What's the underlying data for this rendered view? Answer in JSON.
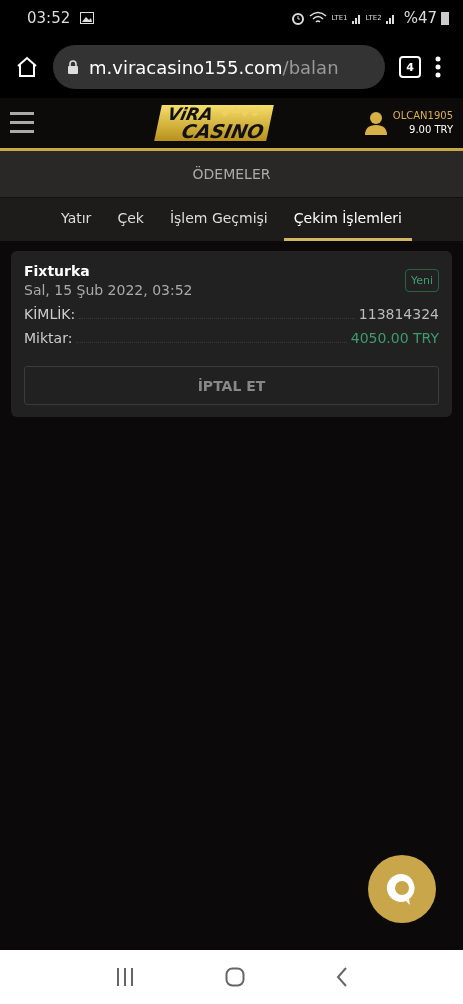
{
  "status_bar": {
    "time": "03:52",
    "sims": [
      "LTE1",
      "LTE2"
    ],
    "battery": "%47"
  },
  "browser": {
    "url_host": "m.viracasino155.com",
    "url_path": "/balan",
    "tab_count": "4"
  },
  "header": {
    "logo": [
      "ViRA",
      "CASINO"
    ],
    "username": "OLCAN1905",
    "balance": "9.00 TRY"
  },
  "section_title": "ÖDEMELER",
  "tabs": [
    {
      "label": "Yatır",
      "selected": false
    },
    {
      "label": "Çek",
      "selected": false
    },
    {
      "label": "İşlem Geçmişi",
      "selected": false
    },
    {
      "label": "Çekim İşlemleri",
      "selected": true
    }
  ],
  "withdrawals": [
    {
      "method": "Fixturka",
      "date": "Sal, 15 Şub 2022, 03:52",
      "status": "Yeni",
      "fields": [
        {
          "label": "KİMLİK:",
          "value": "113814324",
          "kind": "plain"
        },
        {
          "label": "Miktar:",
          "value": "4050.00 TRY",
          "kind": "amount"
        }
      ],
      "button": "İPTAL ET"
    }
  ]
}
